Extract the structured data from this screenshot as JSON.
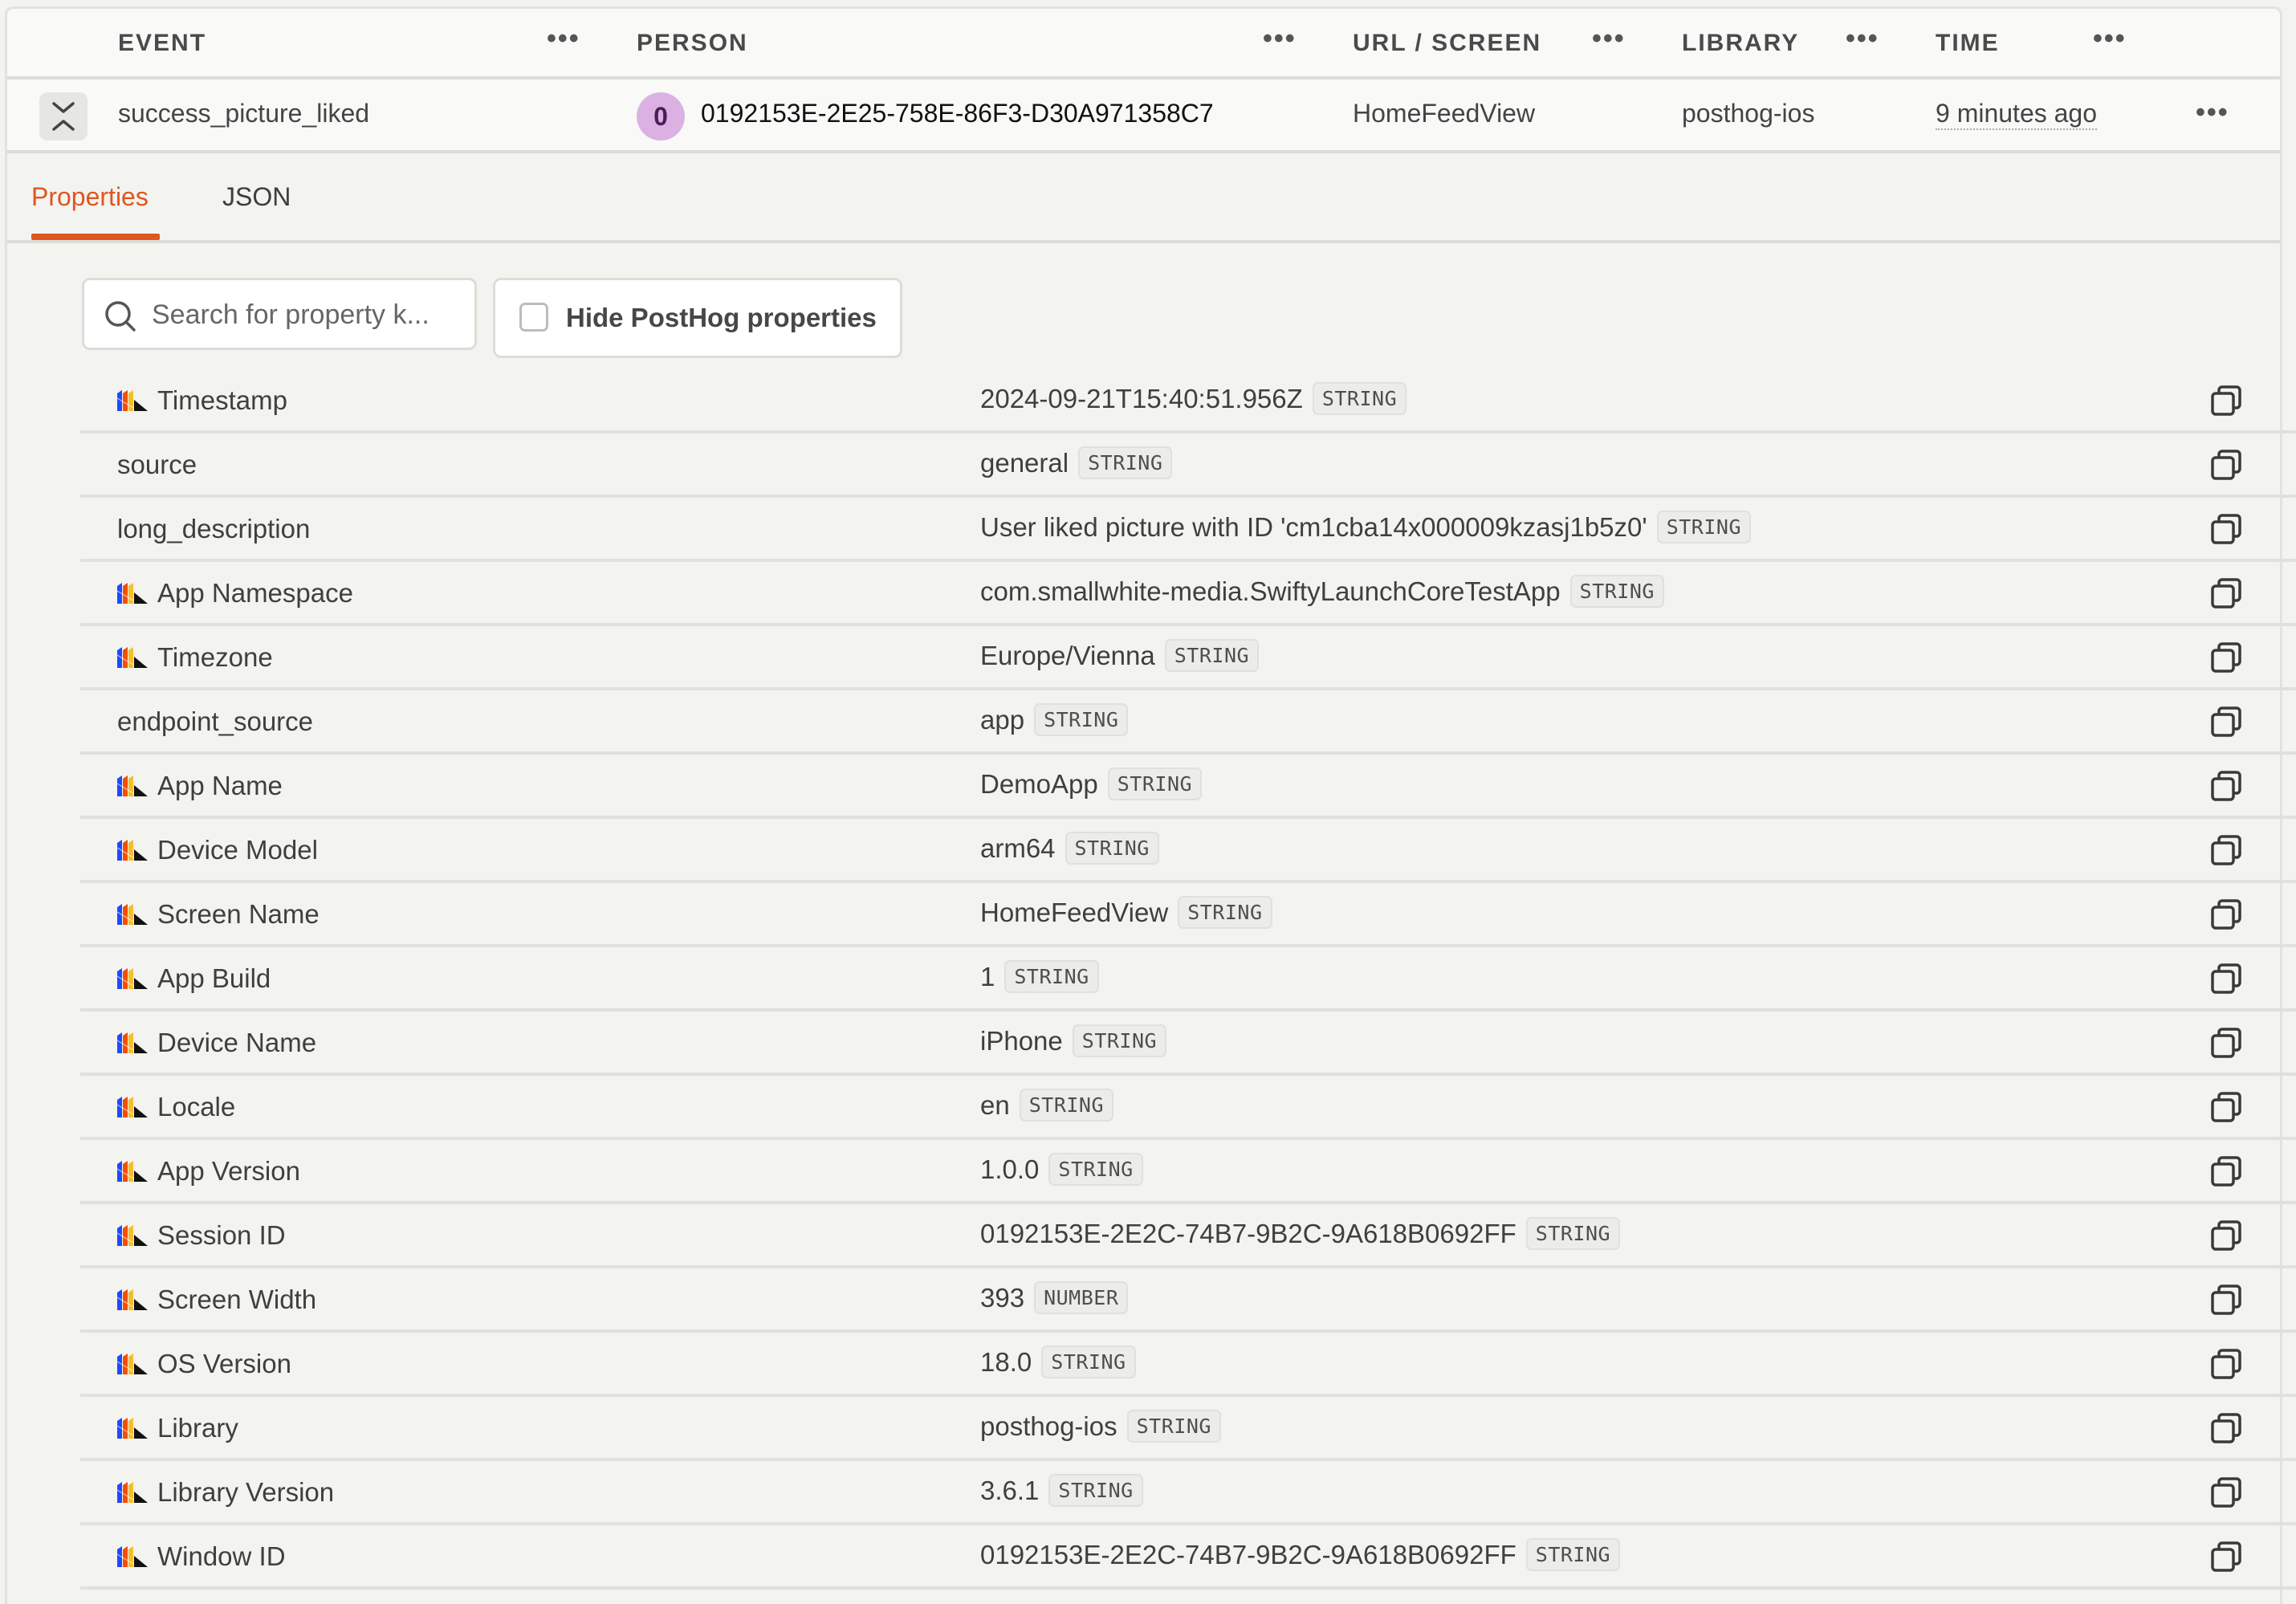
{
  "table": {
    "columns": [
      {
        "label": "EVENT",
        "menu_icon": "more-horizontal-icon"
      },
      {
        "label": "PERSON",
        "menu_icon": "more-horizontal-icon"
      },
      {
        "label": "URL / SCREEN",
        "menu_icon": "more-horizontal-icon"
      },
      {
        "label": "LIBRARY",
        "menu_icon": "more-horizontal-icon"
      },
      {
        "label": "TIME",
        "menu_icon": "more-horizontal-icon"
      }
    ],
    "more_glyph": "•••",
    "row": {
      "expand_icon": "collapse-chevrons-icon",
      "event": "success_picture_liked",
      "person_avatar_initial": "0",
      "person_avatar_color": "#dbb1e3",
      "person_id": "0192153E-2E25-758E-86F3-D30A971358C7",
      "url_screen": "HomeFeedView",
      "library": "posthog-ios",
      "time": "9 minutes ago",
      "actions_icon": "more-horizontal-icon"
    }
  },
  "tabs": [
    {
      "label": "Properties",
      "active": true
    },
    {
      "label": "JSON",
      "active": false
    }
  ],
  "accent_color": "#e0561f",
  "search": {
    "placeholder": "Search for property k...",
    "value": "",
    "icon": "search-icon"
  },
  "hide_posthog": {
    "label": "Hide PostHog properties",
    "checked": false
  },
  "properties": [
    {
      "key": "Timestamp",
      "posthog": true,
      "value": "2024-09-21T15:40:51.956Z",
      "type": "STRING"
    },
    {
      "key": "source",
      "posthog": false,
      "value": "general",
      "type": "STRING"
    },
    {
      "key": "long_description",
      "posthog": false,
      "value": "User liked picture with ID 'cm1cba14x000009kzasj1b5z0'",
      "type": "STRING"
    },
    {
      "key": "App Namespace",
      "posthog": true,
      "value": "com.smallwhite-media.SwiftyLaunchCoreTestApp",
      "type": "STRING"
    },
    {
      "key": "Timezone",
      "posthog": true,
      "value": "Europe/Vienna",
      "type": "STRING"
    },
    {
      "key": "endpoint_source",
      "posthog": false,
      "value": "app",
      "type": "STRING"
    },
    {
      "key": "App Name",
      "posthog": true,
      "value": "DemoApp",
      "type": "STRING"
    },
    {
      "key": "Device Model",
      "posthog": true,
      "value": "arm64",
      "type": "STRING"
    },
    {
      "key": "Screen Name",
      "posthog": true,
      "value": "HomeFeedView",
      "type": "STRING"
    },
    {
      "key": "App Build",
      "posthog": true,
      "value": "1",
      "type": "STRING"
    },
    {
      "key": "Device Name",
      "posthog": true,
      "value": "iPhone",
      "type": "STRING"
    },
    {
      "key": "Locale",
      "posthog": true,
      "value": "en",
      "type": "STRING"
    },
    {
      "key": "App Version",
      "posthog": true,
      "value": "1.0.0",
      "type": "STRING"
    },
    {
      "key": "Session ID",
      "posthog": true,
      "value": "0192153E-2E2C-74B7-9B2C-9A618B0692FF",
      "type": "STRING"
    },
    {
      "key": "Screen Width",
      "posthog": true,
      "value": "393",
      "type": "NUMBER"
    },
    {
      "key": "OS Version",
      "posthog": true,
      "value": "18.0",
      "type": "STRING"
    },
    {
      "key": "Library",
      "posthog": true,
      "value": "posthog-ios",
      "type": "STRING"
    },
    {
      "key": "Library Version",
      "posthog": true,
      "value": "3.6.1",
      "type": "STRING"
    },
    {
      "key": "Window ID",
      "posthog": true,
      "value": "0192153E-2E2C-74B7-9B2C-9A618B0692FF",
      "type": "STRING"
    }
  ]
}
